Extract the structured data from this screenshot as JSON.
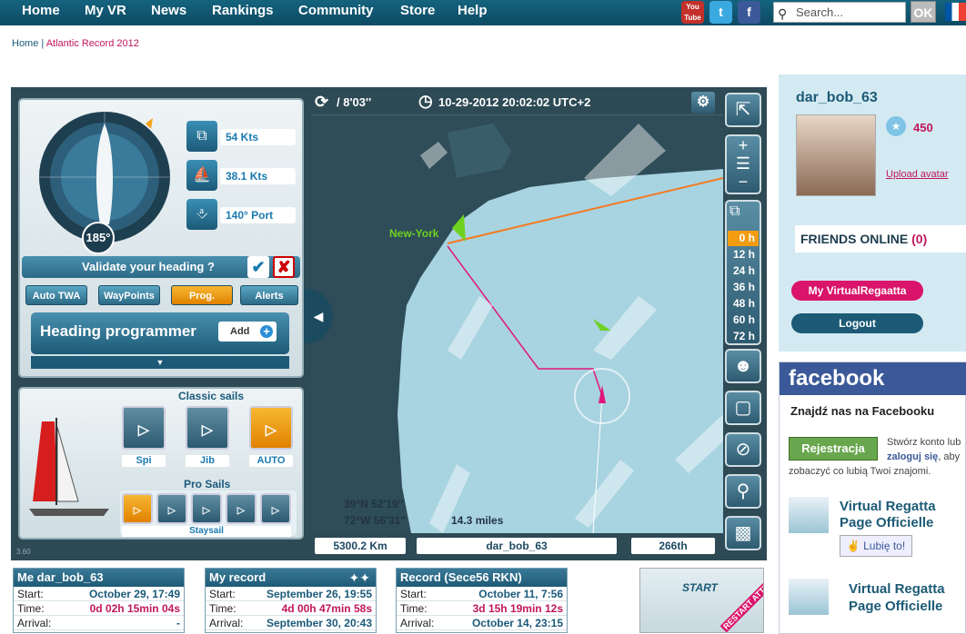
{
  "nav": {
    "items": [
      "Home",
      "My VR",
      "News",
      "Rankings",
      "Community",
      "Store",
      "Help"
    ],
    "social": [
      "You Tube",
      "t",
      "f"
    ],
    "search_placeholder": "Search...",
    "ok_label": "OK"
  },
  "breadcrumb": {
    "home": "Home",
    "sep": " | ",
    "current": "Atlantic Record 2012"
  },
  "game": {
    "compass_heading": "185°",
    "wind_speed": "54 Kts",
    "boat_speed": "38.1 Kts",
    "wind_angle": "140° Port",
    "validate_label": "Validate your heading ?",
    "tabs": [
      "Auto TWA",
      "WayPoints",
      "Prog.",
      "Alerts"
    ],
    "heading_programmer": "Heading programmer",
    "add_label": "Add",
    "classic_sails_title": "Classic sails",
    "classic_sails": [
      "Spi",
      "Jib",
      "AUTO"
    ],
    "pro_sails_title": "Pro Sails",
    "pro_sail_name": "Staysail",
    "version": "3.60",
    "cycle": "/ 8'03''",
    "datetime": "10-29-2012 20:02:02 UTC+2",
    "map_label_city": "New-York",
    "coord_lat": "39°N 52'19''",
    "coord_lon": "72°W 56'31''",
    "distance_miles": "14.3 miles",
    "distance_km": "5300.2 Km",
    "player_name": "dar_bob_63",
    "rank": "266th",
    "forecast_hours": [
      "0 h",
      "12 h",
      "24 h",
      "36 h",
      "48 h",
      "60 h",
      "72 h"
    ]
  },
  "stats": [
    {
      "title": "Me dar_bob_63",
      "rows": [
        [
          "Start:",
          "October 29, 17:49"
        ],
        [
          "Time:",
          "0d 02h 15min 04s"
        ],
        [
          "Arrival:",
          "-"
        ]
      ]
    },
    {
      "title": "My record",
      "rows": [
        [
          "Start:",
          "September 26, 19:55"
        ],
        [
          "Time:",
          "4d 00h 47min 58s"
        ],
        [
          "Arrival:",
          "September 30, 20:43"
        ]
      ]
    },
    {
      "title": "Record (Sece56 RKN)",
      "rows": [
        [
          "Start:",
          "October 11, 7:56"
        ],
        [
          "Time:",
          "3d 15h 19min 12s"
        ],
        [
          "Arrival:",
          "October 14, 23:15"
        ]
      ]
    }
  ],
  "restart": {
    "start": "START",
    "restart": "RESTART ATTEMPT"
  },
  "sidebar": {
    "username": "dar_bob_63",
    "points": "450",
    "upload_avatar": "Upload avatar",
    "friends_online": "FRIENDS ONLINE",
    "friends_count": "(0)",
    "my_vr": "My VirtualRegaatta",
    "logout": "Logout"
  },
  "facebook": {
    "logo": "facebook",
    "find_us": "Znajdź nas na Facebooku",
    "register": "Rejestracja",
    "register_text_1": "Stwórz konto lub",
    "register_text_2": "zaloguj się",
    "register_text_3": ", aby",
    "register_text_4": "zobaczyć co lubią Twoi znajomi.",
    "page1": "Virtual Regatta Page Officielle",
    "like": "Lubię to!",
    "page2": "Virtual Regatta Page Officielle"
  }
}
